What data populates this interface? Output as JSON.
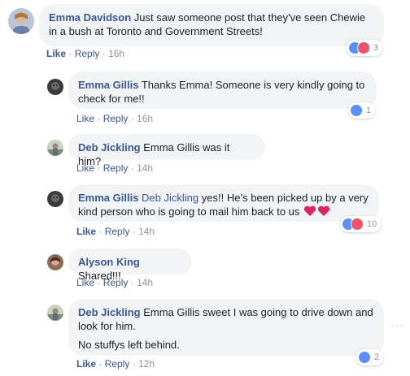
{
  "comments": [
    {
      "name": "Emma Davidson",
      "text": "Just saw someone post that they've seen Chewie in a bush at Toronto and Government Streets!",
      "like": "Like",
      "reply": "Reply",
      "time": "16h",
      "reactions": "3"
    },
    {
      "name": "Emma Gillis",
      "text": "Thanks Emma! Someone is very kindly going to check for me!!",
      "like": "Like",
      "reply": "Reply",
      "time": "16h",
      "reactions": "1"
    },
    {
      "name": "Deb Jickling",
      "text": "Emma Gillis was it him?",
      "like": "Like",
      "reply": "Reply",
      "time": "14h"
    },
    {
      "name": "Emma Gillis",
      "mention": "Deb Jickling",
      "text": "yes!! He’s been picked up by a very kind person who is going to mail him back to us",
      "like": "Like",
      "reply": "Reply",
      "time": "14h",
      "reactions": "10"
    },
    {
      "name": "Alyson King",
      "text": "Shared!!!",
      "like": "Like",
      "reply": "Reply",
      "time": "14h"
    },
    {
      "name": "Deb Jickling",
      "text": "Emma Gillis sweet I was going to drive down and look for him.",
      "text2": "No stuffys left behind.",
      "like": "Like",
      "reply": "Reply",
      "time": "12h",
      "reactions": "2"
    }
  ],
  "separator": "·",
  "more_options": "···",
  "colors": {
    "link": "#385898",
    "bubble": "#f2f3f5",
    "meta": "#90949c",
    "like_blue": "#5890ff",
    "love_red": "#f25268"
  }
}
